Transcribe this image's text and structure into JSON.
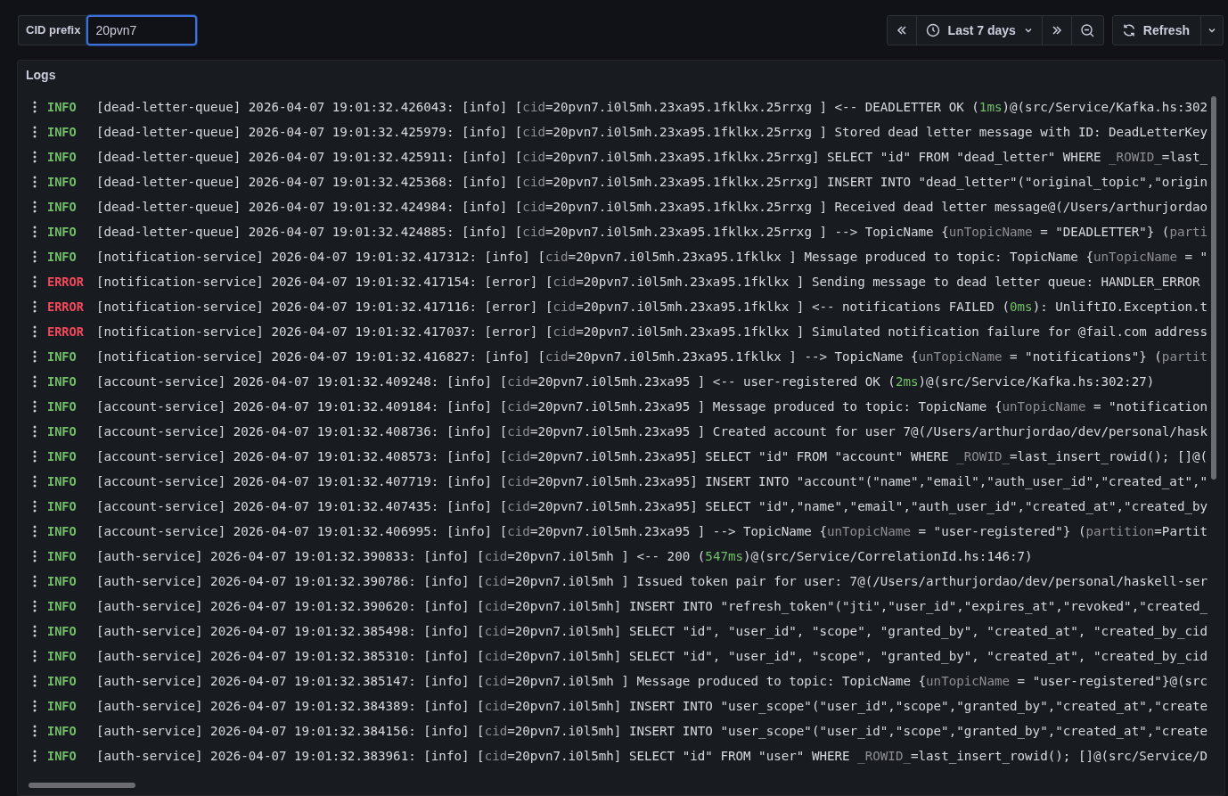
{
  "filter": {
    "label": "CID prefix",
    "value": "20pvn7"
  },
  "toolbar": {
    "time_range": "Last 7 days",
    "refresh": "Refresh"
  },
  "panel": {
    "title": "Logs"
  },
  "logs": [
    {
      "severity": "INFO",
      "kind": "info",
      "parts": [
        "[dead-letter-queue] 2026-04-07 19:01:32.426043: [info] [",
        {
          "text": "cid",
          "kind": "key"
        },
        "=20pvn7.i0l5mh.23xa95.1fklkx.25rrxg ] <-- DEADLETTER OK (",
        {
          "text": "1ms",
          "kind": "duration"
        },
        ")@(src/Service/Kafka.hs:302"
      ]
    },
    {
      "severity": "INFO",
      "kind": "info",
      "parts": [
        "[dead-letter-queue] 2026-04-07 19:01:32.425979: [info] [",
        {
          "text": "cid",
          "kind": "key"
        },
        "=20pvn7.i0l5mh.23xa95.1fklkx.25rrxg ] Stored dead letter message with ID: DeadLetterKey"
      ]
    },
    {
      "severity": "INFO",
      "kind": "info",
      "parts": [
        "[dead-letter-queue] 2026-04-07 19:01:32.425911: [info] [",
        {
          "text": "cid",
          "kind": "key"
        },
        "=20pvn7.i0l5mh.23xa95.1fklkx.25rrxg] SELECT \"id\" FROM \"dead_letter\" WHERE ",
        {
          "text": "_ROWID_",
          "kind": "key"
        },
        "=last_"
      ]
    },
    {
      "severity": "INFO",
      "kind": "info",
      "parts": [
        "[dead-letter-queue] 2026-04-07 19:01:32.425368: [info] [",
        {
          "text": "cid",
          "kind": "key"
        },
        "=20pvn7.i0l5mh.23xa95.1fklkx.25rrxg] INSERT INTO \"dead_letter\"(\"original_topic\",\"origin"
      ]
    },
    {
      "severity": "INFO",
      "kind": "info",
      "parts": [
        "[dead-letter-queue] 2026-04-07 19:01:32.424984: [info] [",
        {
          "text": "cid",
          "kind": "key"
        },
        "=20pvn7.i0l5mh.23xa95.1fklkx.25rrxg ] Received dead letter message@(/Users/arthurjordao"
      ]
    },
    {
      "severity": "INFO",
      "kind": "info",
      "parts": [
        "[dead-letter-queue] 2026-04-07 19:01:32.424885: [info] [",
        {
          "text": "cid",
          "kind": "key"
        },
        "=20pvn7.i0l5mh.23xa95.1fklkx.25rrxg ] --> TopicName {",
        {
          "text": "unTopicName",
          "kind": "key"
        },
        " = \"DEADLETTER\"} (",
        {
          "text": "parti",
          "kind": "key"
        }
      ]
    },
    {
      "severity": "INFO",
      "kind": "info",
      "parts": [
        "[notification-service] 2026-04-07 19:01:32.417312: [info] [",
        {
          "text": "cid",
          "kind": "key"
        },
        "=20pvn7.i0l5mh.23xa95.1fklkx ] Message produced to topic: TopicName {",
        {
          "text": "unTopicName",
          "kind": "key"
        },
        " = \""
      ]
    },
    {
      "severity": "ERROR",
      "kind": "error",
      "parts": [
        "[notification-service] 2026-04-07 19:01:32.417154: [error] [",
        {
          "text": "cid",
          "kind": "key"
        },
        "=20pvn7.i0l5mh.23xa95.1fklkx ] Sending message to dead letter queue: HANDLER_ERROR"
      ]
    },
    {
      "severity": "ERROR",
      "kind": "error",
      "parts": [
        "[notification-service] 2026-04-07 19:01:32.417116: [error] [",
        {
          "text": "cid",
          "kind": "key"
        },
        "=20pvn7.i0l5mh.23xa95.1fklkx ] <-- notifications FAILED (",
        {
          "text": "0ms",
          "kind": "duration"
        },
        "): UnliftIO.Exception.t"
      ]
    },
    {
      "severity": "ERROR",
      "kind": "error",
      "parts": [
        "[notification-service] 2026-04-07 19:01:32.417037: [error] [",
        {
          "text": "cid",
          "kind": "key"
        },
        "=20pvn7.i0l5mh.23xa95.1fklkx ] Simulated notification failure for @fail.com address"
      ]
    },
    {
      "severity": "INFO",
      "kind": "info",
      "parts": [
        "[notification-service] 2026-04-07 19:01:32.416827: [info] [",
        {
          "text": "cid",
          "kind": "key"
        },
        "=20pvn7.i0l5mh.23xa95.1fklkx ] --> TopicName {",
        {
          "text": "unTopicName",
          "kind": "key"
        },
        " = \"notifications\"} (",
        {
          "text": "partit",
          "kind": "key"
        }
      ]
    },
    {
      "severity": "INFO",
      "kind": "info",
      "parts": [
        "[account-service] 2026-04-07 19:01:32.409248: [info] [",
        {
          "text": "cid",
          "kind": "key"
        },
        "=20pvn7.i0l5mh.23xa95 ] <-- user-registered OK (",
        {
          "text": "2ms",
          "kind": "duration"
        },
        ")@(src/Service/Kafka.hs:302:27)"
      ]
    },
    {
      "severity": "INFO",
      "kind": "info",
      "parts": [
        "[account-service] 2026-04-07 19:01:32.409184: [info] [",
        {
          "text": "cid",
          "kind": "key"
        },
        "=20pvn7.i0l5mh.23xa95 ] Message produced to topic: TopicName {",
        {
          "text": "unTopicName",
          "kind": "key"
        },
        " = \"notification"
      ]
    },
    {
      "severity": "INFO",
      "kind": "info",
      "parts": [
        "[account-service] 2026-04-07 19:01:32.408736: [info] [",
        {
          "text": "cid",
          "kind": "key"
        },
        "=20pvn7.i0l5mh.23xa95 ] Created account for user 7@(/Users/arthurjordao/dev/personal/hask"
      ]
    },
    {
      "severity": "INFO",
      "kind": "info",
      "parts": [
        "[account-service] 2026-04-07 19:01:32.408573: [info] [",
        {
          "text": "cid",
          "kind": "key"
        },
        "=20pvn7.i0l5mh.23xa95] SELECT \"id\" FROM \"account\" WHERE ",
        {
          "text": "_ROWID_",
          "kind": "key"
        },
        "=last_insert_rowid(); []@("
      ]
    },
    {
      "severity": "INFO",
      "kind": "info",
      "parts": [
        "[account-service] 2026-04-07 19:01:32.407719: [info] [",
        {
          "text": "cid",
          "kind": "key"
        },
        "=20pvn7.i0l5mh.23xa95] INSERT INTO \"account\"(\"name\",\"email\",\"auth_user_id\",\"created_at\",\""
      ]
    },
    {
      "severity": "INFO",
      "kind": "info",
      "parts": [
        "[account-service] 2026-04-07 19:01:32.407435: [info] [",
        {
          "text": "cid",
          "kind": "key"
        },
        "=20pvn7.i0l5mh.23xa95] SELECT \"id\",\"name\",\"email\",\"auth_user_id\",\"created_at\",\"created_by"
      ]
    },
    {
      "severity": "INFO",
      "kind": "info",
      "parts": [
        "[account-service] 2026-04-07 19:01:32.406995: [info] [",
        {
          "text": "cid",
          "kind": "key"
        },
        "=20pvn7.i0l5mh.23xa95 ] --> TopicName {",
        {
          "text": "unTopicName",
          "kind": "key"
        },
        " = \"user-registered\"} (",
        {
          "text": "partition",
          "kind": "key"
        },
        "=Partit"
      ]
    },
    {
      "severity": "INFO",
      "kind": "info",
      "parts": [
        "[auth-service] 2026-04-07 19:01:32.390833: [info] [",
        {
          "text": "cid",
          "kind": "key"
        },
        "=20pvn7.i0l5mh ] <-- 200 (",
        {
          "text": "547ms",
          "kind": "duration"
        },
        ")@(src/Service/CorrelationId.hs:146:7)"
      ]
    },
    {
      "severity": "INFO",
      "kind": "info",
      "parts": [
        "[auth-service] 2026-04-07 19:01:32.390786: [info] [",
        {
          "text": "cid",
          "kind": "key"
        },
        "=20pvn7.i0l5mh ] Issued token pair for user: 7@(/Users/arthurjordao/dev/personal/haskell-ser"
      ]
    },
    {
      "severity": "INFO",
      "kind": "info",
      "parts": [
        "[auth-service] 2026-04-07 19:01:32.390620: [info] [",
        {
          "text": "cid",
          "kind": "key"
        },
        "=20pvn7.i0l5mh] INSERT INTO \"refresh_token\"(\"jti\",\"user_id\",\"expires_at\",\"revoked\",\"created_"
      ]
    },
    {
      "severity": "INFO",
      "kind": "info",
      "parts": [
        "[auth-service] 2026-04-07 19:01:32.385498: [info] [",
        {
          "text": "cid",
          "kind": "key"
        },
        "=20pvn7.i0l5mh] SELECT \"id\", \"user_id\", \"scope\", \"granted_by\", \"created_at\", \"created_by_cid"
      ]
    },
    {
      "severity": "INFO",
      "kind": "info",
      "parts": [
        "[auth-service] 2026-04-07 19:01:32.385310: [info] [",
        {
          "text": "cid",
          "kind": "key"
        },
        "=20pvn7.i0l5mh] SELECT \"id\", \"user_id\", \"scope\", \"granted_by\", \"created_at\", \"created_by_cid"
      ]
    },
    {
      "severity": "INFO",
      "kind": "info",
      "parts": [
        "[auth-service] 2026-04-07 19:01:32.385147: [info] [",
        {
          "text": "cid",
          "kind": "key"
        },
        "=20pvn7.i0l5mh ] Message produced to topic: TopicName {",
        {
          "text": "unTopicName",
          "kind": "key"
        },
        " = \"user-registered\"}@(src"
      ]
    },
    {
      "severity": "INFO",
      "kind": "info",
      "parts": [
        "[auth-service] 2026-04-07 19:01:32.384389: [info] [",
        {
          "text": "cid",
          "kind": "key"
        },
        "=20pvn7.i0l5mh] INSERT INTO \"user_scope\"(\"user_id\",\"scope\",\"granted_by\",\"created_at\",\"create"
      ]
    },
    {
      "severity": "INFO",
      "kind": "info",
      "parts": [
        "[auth-service] 2026-04-07 19:01:32.384156: [info] [",
        {
          "text": "cid",
          "kind": "key"
        },
        "=20pvn7.i0l5mh] INSERT INTO \"user_scope\"(\"user_id\",\"scope\",\"granted_by\",\"created_at\",\"create"
      ]
    },
    {
      "severity": "INFO",
      "kind": "info",
      "parts": [
        "[auth-service] 2026-04-07 19:01:32.383961: [info] [",
        {
          "text": "cid",
          "kind": "key"
        },
        "=20pvn7.i0l5mh] SELECT \"id\" FROM \"user\" WHERE ",
        {
          "text": "_ROWID_",
          "kind": "key"
        },
        "=last_insert_rowid(); []@(src/Service/D"
      ]
    }
  ]
}
